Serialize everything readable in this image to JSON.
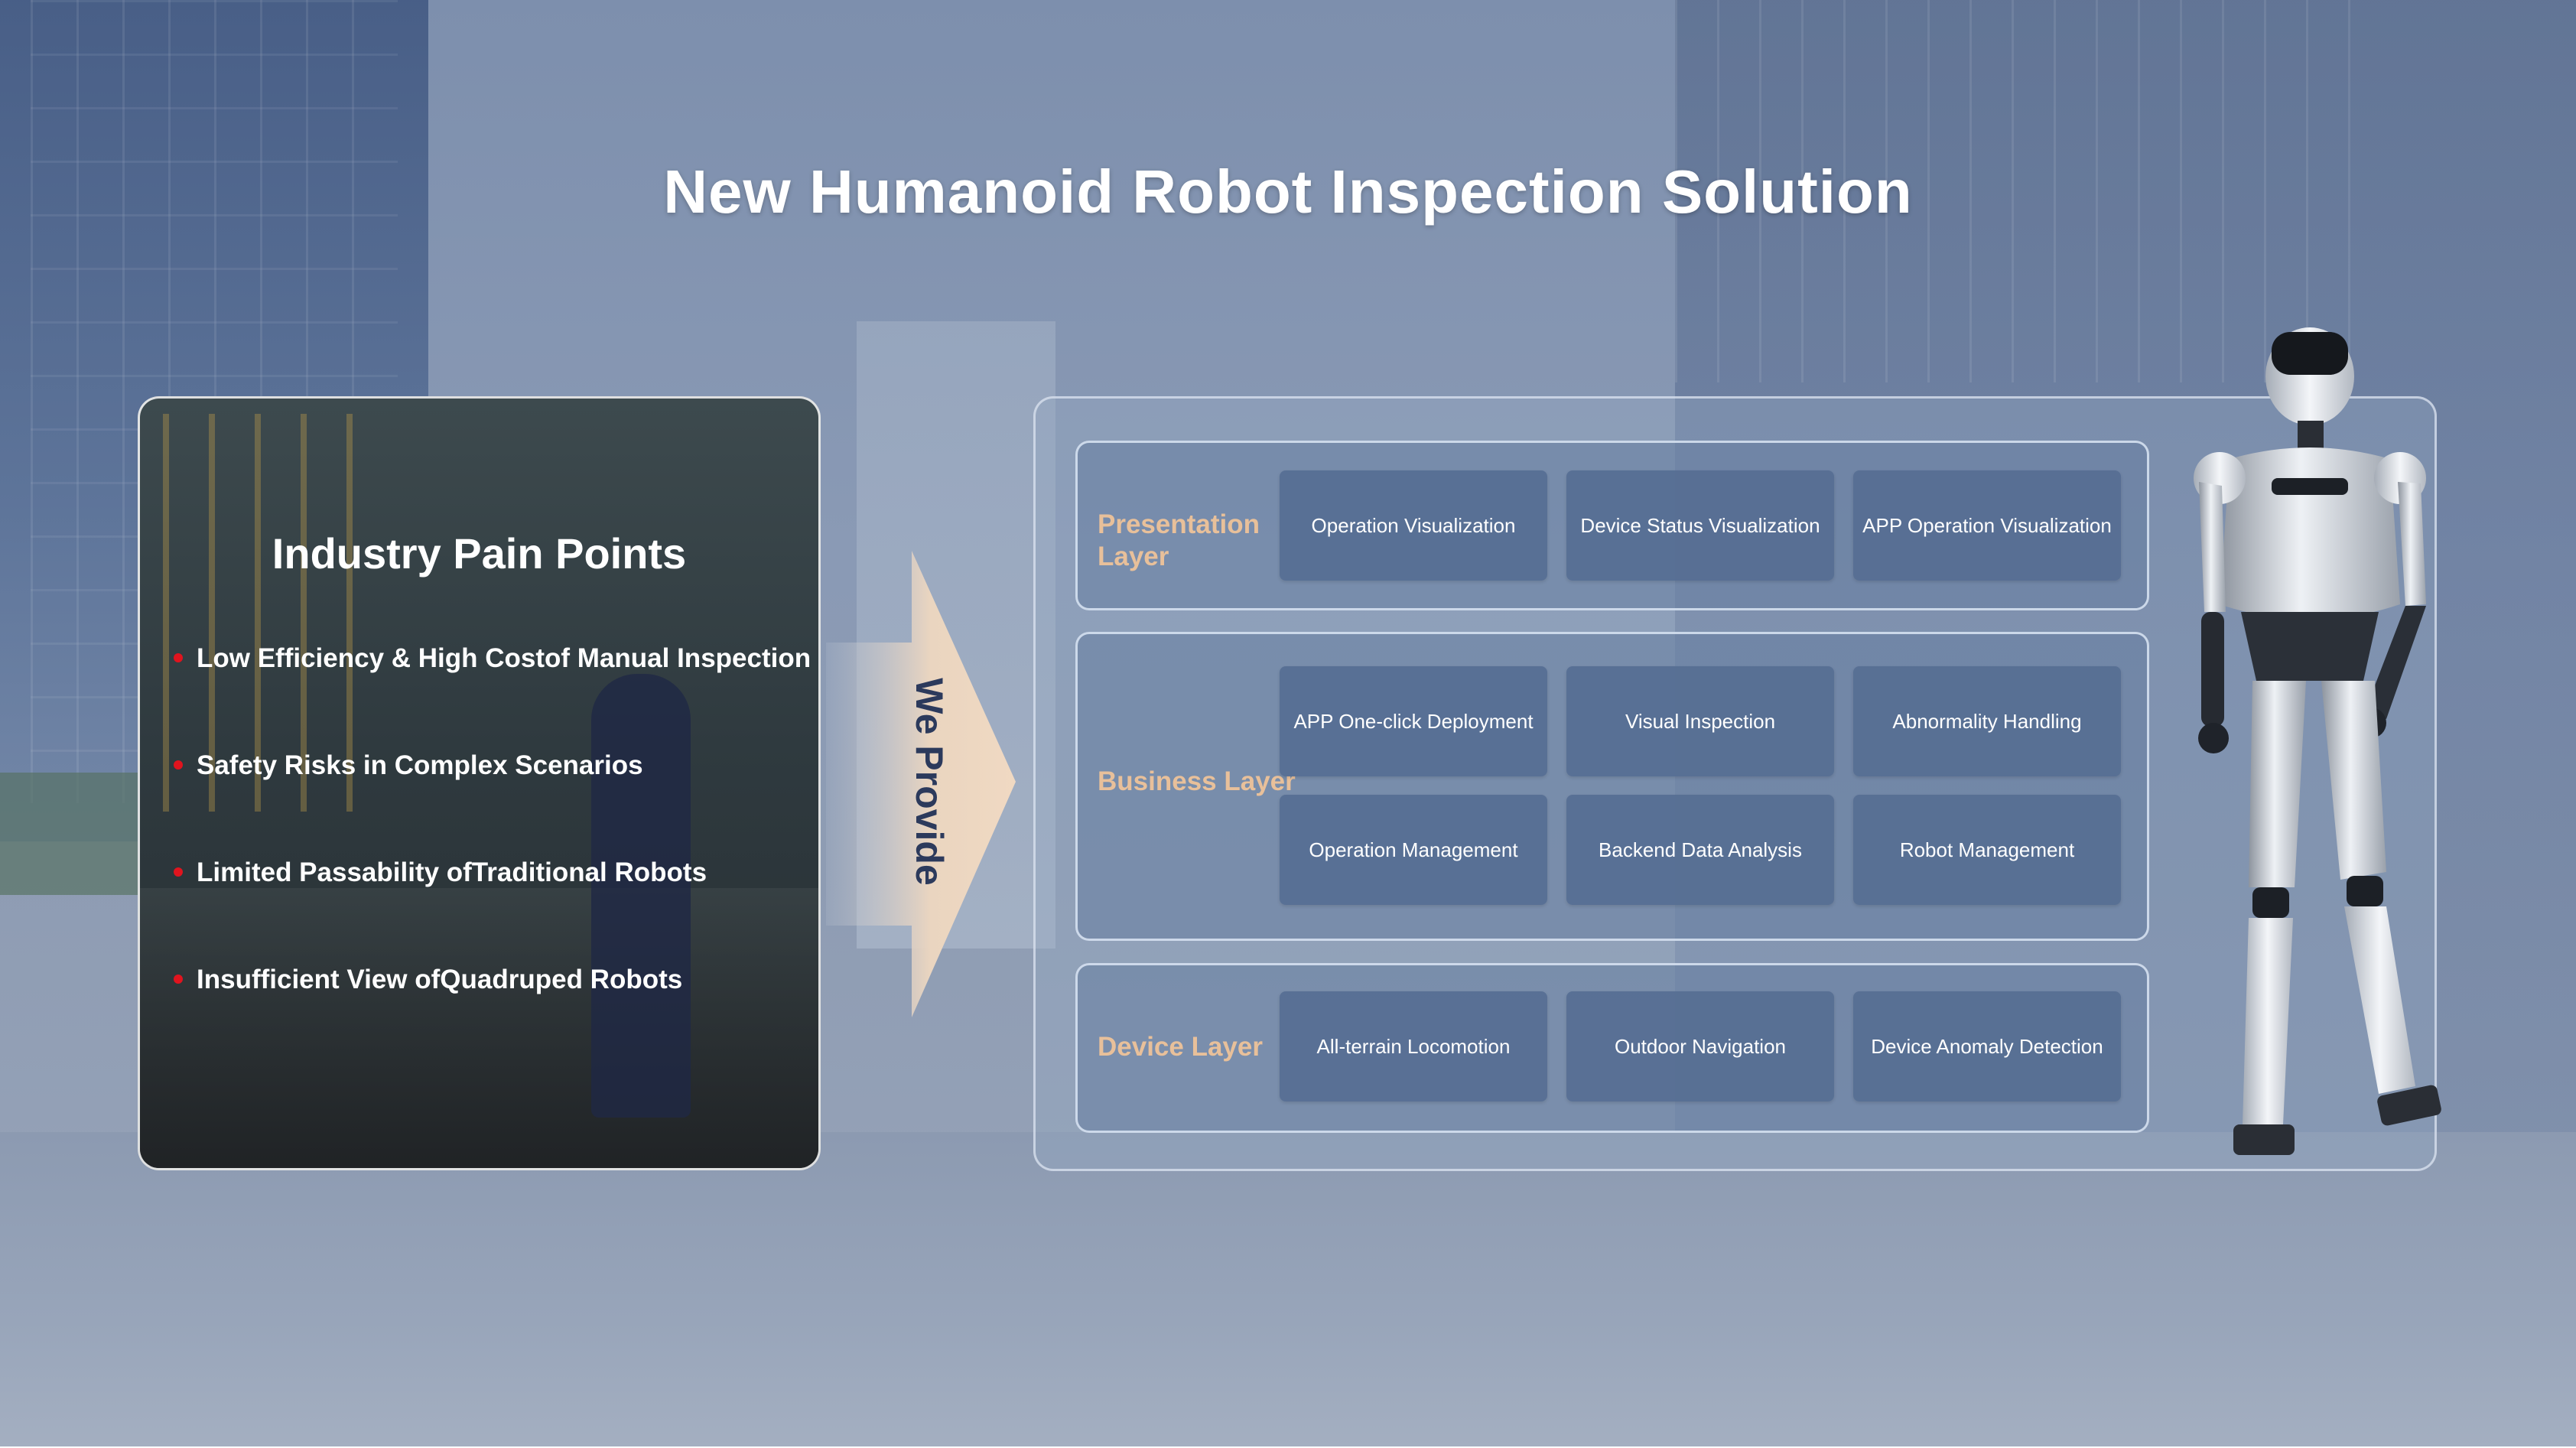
{
  "title": "New Humanoid Robot Inspection Solution",
  "pain_points": {
    "heading": "Industry Pain Points",
    "items": [
      "Low Efficiency & High Costof Manual Inspection",
      "Safety Risks in Complex Scenarios",
      "Limited Passability ofTraditional Robots",
      "Insufficient View ofQuadruped Robots"
    ]
  },
  "arrow_label": "We Provide",
  "architecture": {
    "layers": [
      {
        "label": "Presentation\nLayer",
        "items": [
          "Operation Visualization",
          "Device Status Visualization",
          "APP Operation Visualization"
        ]
      },
      {
        "label": "Business Layer",
        "items": [
          "APP One-click Deployment",
          "Visual Inspection",
          "Abnormality Handling",
          "Operation Management",
          "Backend Data Analysis",
          "Robot Management"
        ]
      },
      {
        "label": "Device Layer",
        "items": [
          "All-terrain Locomotion",
          "Outdoor Navigation",
          "Device Anomaly Detection"
        ]
      }
    ]
  },
  "colors": {
    "accent_label": "#e8c09a",
    "bullet": "#e0141e",
    "arrow_text": "#2c3a5c"
  },
  "icons": [
    "bullet-dot-icon",
    "arrow-right-icon",
    "humanoid-robot-icon"
  ]
}
